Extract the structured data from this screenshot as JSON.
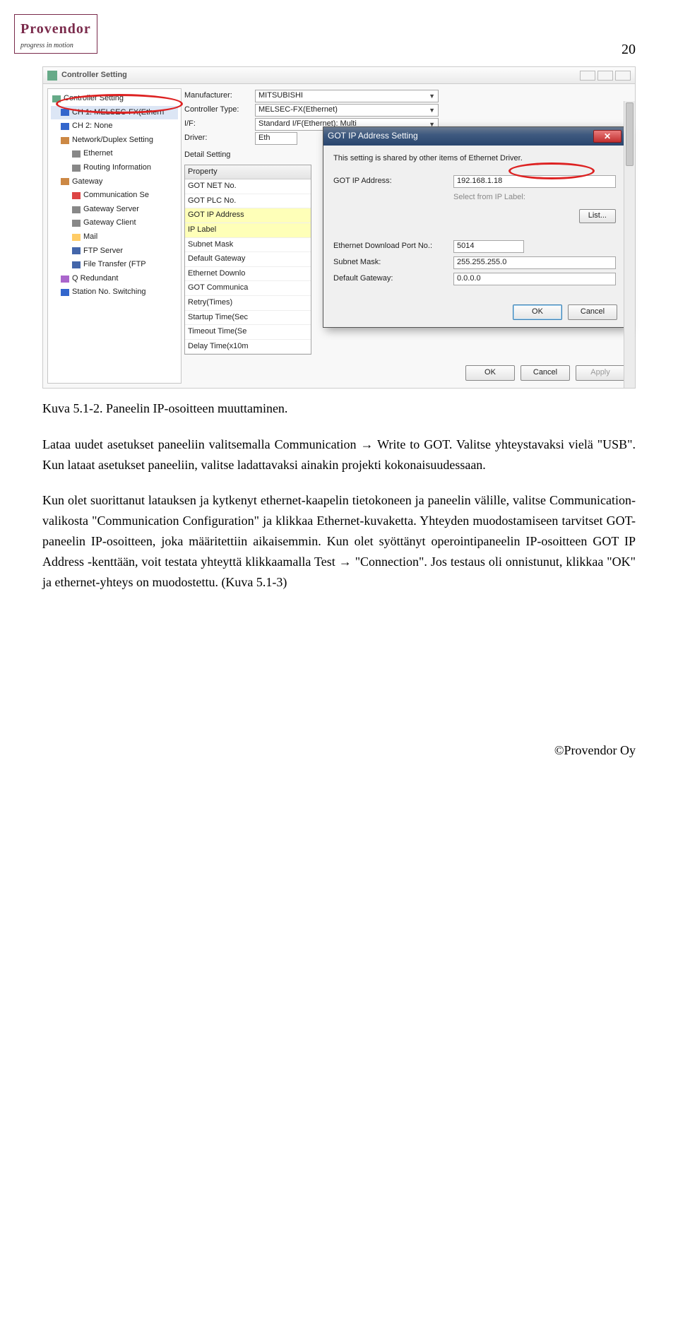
{
  "logo": {
    "brand": "Provendor",
    "tagline": "progress in motion"
  },
  "page_number": "20",
  "screenshot": {
    "window_title": "Controller Setting",
    "tree": {
      "root": "Controller Setting",
      "ch1": "CH 1: MELSEC-FX(Ethern",
      "ch2": "CH 2: None",
      "nds": "Network/Duplex Setting",
      "eth": "Ethernet",
      "routing": "Routing Information",
      "gateway": "Gateway",
      "commse": "Communication Se",
      "gwserver": "Gateway Server",
      "gwclient": "Gateway Client",
      "mail": "Mail",
      "ftpserver": "FTP Server",
      "filetransfer": "File Transfer (FTP",
      "qr": "Q Redundant",
      "stn": "Station No. Switching"
    },
    "form": {
      "manufacturer_label": "Manufacturer:",
      "manufacturer_value": "MITSUBISHI",
      "ctrltype_label": "Controller Type:",
      "ctrltype_value": "MELSEC-FX(Ethernet)",
      "if_label": "I/F:",
      "if_value": "Standard I/F(Ethernet): Multi",
      "driver_label": "Driver:",
      "driver_value": "Eth",
      "detail_label": "Detail Setting"
    },
    "properties": {
      "header": "Property",
      "rows": [
        "GOT NET No.",
        "GOT PLC No.",
        "GOT IP Address",
        "IP Label",
        "Subnet Mask",
        "Default Gateway",
        "Ethernet Downlo",
        "GOT Communica",
        "Retry(Times)",
        "Startup Time(Sec",
        "Timeout Time(Se",
        "Delay Time(x10m"
      ]
    },
    "modal": {
      "title": "GOT IP Address Setting",
      "note": "This setting is shared by other items of Ethernet Driver.",
      "ip_label": "GOT IP Address:",
      "ip_value": "192.168.1.18",
      "select_link": "Select from IP Label:",
      "list_btn": "List...",
      "port_label": "Ethernet Download Port No.:",
      "port_value": "5014",
      "subnet_label": "Subnet Mask:",
      "subnet_value": "255.255.255.0",
      "gw_label": "Default Gateway:",
      "gw_value": "0.0.0.0",
      "ok": "OK",
      "cancel": "Cancel"
    },
    "outer_buttons": {
      "ok": "OK",
      "cancel": "Cancel",
      "apply": "Apply"
    }
  },
  "caption": "Kuva 5.1-2. Paneelin IP-osoitteen muuttaminen.",
  "para1": "Lataa uudet asetukset paneeliin valitsemalla Communication → Write to GOT. Valitse yhteystavaksi vielä \"USB\". Kun lataat asetukset paneeliin, valitse ladattavaksi ainakin projekti kokonaisuudessaan.",
  "para2": "Kun olet suorittanut latauksen ja kytkenyt ethernet-kaapelin tietokoneen ja paneelin välille, valitse Communication-valikosta \"Communication Configuration\" ja klikkaa Ethernet-kuvaketta. Yhteyden muodostamiseen tarvitset GOT-paneelin IP-osoitteen, joka määritettiin aikaisemmin. Kun olet syöttänyt operointipaneelin IP-osoitteen GOT IP Address -kenttään, voit testata yhteyttä klikkaamalla Test → \"Connection\". Jos testaus oli onnistunut, klikkaa \"OK\" ja ethernet-yhteys on muodostettu. (Kuva 5.1-3)",
  "footer": "©Provendor Oy"
}
